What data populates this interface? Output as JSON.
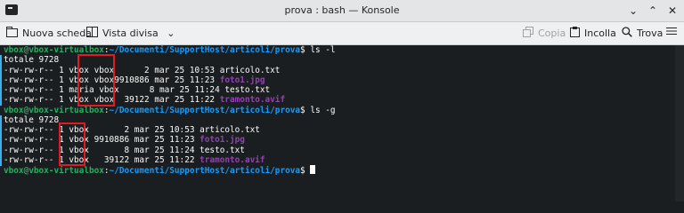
{
  "window": {
    "title": "prova : bash — Konsole"
  },
  "toolbar": {
    "new_tab": "Nuova scheda",
    "split_view": "Vista divisa",
    "copy": "Copia",
    "paste": "Incolla",
    "find": "Trova"
  },
  "terminal": {
    "prompt_user": "vbox@vbox-virtualbox",
    "prompt_path": "~/Documenti/SupportHost/articoli/prova",
    "cmd1": "ls -l",
    "cmd2": "ls -g",
    "total1": "totale 9728",
    "total2": "totale 9728",
    "listing1": [
      {
        "pre": "-rw-rw-r-- 1 vbox ",
        "group": "vbox",
        "post": "      2 mar 25 10:53 ",
        "name": "articolo.txt",
        "colored": false
      },
      {
        "pre": "-rw-rw-r-- 1 vbox ",
        "group": "vbox",
        "post": "9910886 mar 25 11:23 ",
        "name": "foto1.jpg",
        "colored": true
      },
      {
        "pre": "-rw-rw-r-- 1 maria ",
        "group": "vbox",
        "post": "      8 mar 25 11:24 ",
        "name": "testo.txt",
        "colored": false
      },
      {
        "pre": "-rw-rw-r-- 1 vbox ",
        "group": "vbox",
        "post": "  39122 mar 25 11:22 ",
        "name": "tramonto.avif",
        "colored": true
      }
    ],
    "listing2": [
      {
        "pre": "-rw-rw-r-- 1 ",
        "group": "vbox",
        "post": "       2 mar 25 10:53 ",
        "name": "articolo.txt",
        "colored": false
      },
      {
        "pre": "-rw-rw-r-- 1 ",
        "group": "vbox",
        "post": " 9910886 mar 25 11:23 ",
        "name": "foto1.jpg",
        "colored": true
      },
      {
        "pre": "-rw-rw-r-- 1 ",
        "group": "vbox",
        "post": "       8 mar 25 11:24 ",
        "name": "testo.txt",
        "colored": false
      },
      {
        "pre": "-rw-rw-r-- 1 ",
        "group": "vbox",
        "post": "   39122 mar 25 11:22 ",
        "name": "tramonto.avif",
        "colored": true
      }
    ]
  },
  "colors": {
    "user": "#27ae60",
    "path": "#1d99f3",
    "file_media": "#8e44ad",
    "highlight": "#e01b24"
  }
}
